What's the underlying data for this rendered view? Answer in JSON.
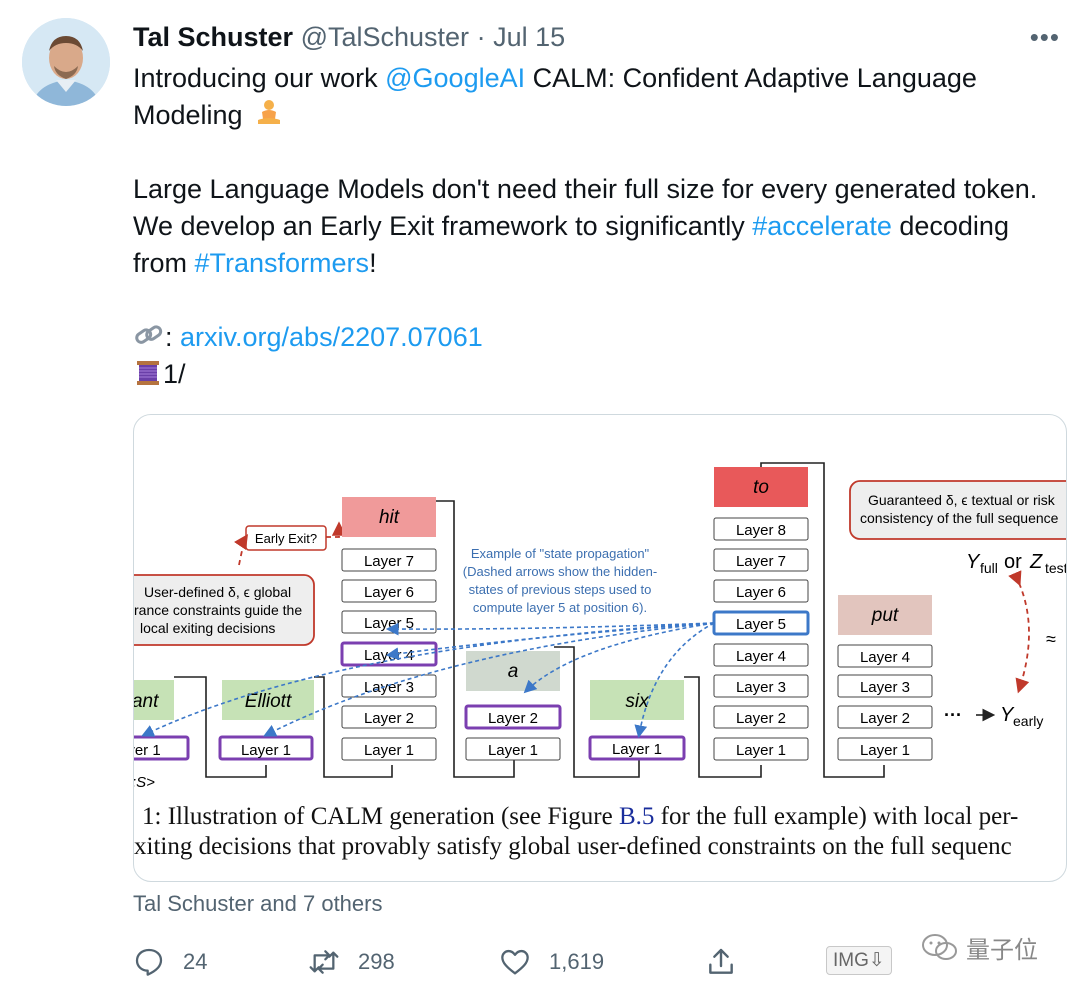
{
  "author": {
    "name": "Tal Schuster",
    "handle": "@TalSchuster",
    "separator": "·",
    "date": "Jul 15"
  },
  "more_label": "•••",
  "tweet": {
    "line1_prefix": "Introducing our work ",
    "mention": "@GoogleAI",
    "line1_suffix": " CALM: Confident Adaptive Language Modeling",
    "para2_prefix": "Large Language Models don't need their full size for every generated token. We develop an Early Exit framework to significantly ",
    "hashtag1": "#accelerate",
    "para2_mid": " decoding from ",
    "hashtag2": "#Transformers",
    "para2_suffix": "!",
    "link_sep": ": ",
    "link": "arxiv.org/abs/2207.07061",
    "thread": "1/"
  },
  "figure": {
    "boxes": {
      "early_exit": "Early Exit?",
      "guaranteed_1": "Guaranteed δ, ϵ textual or risk",
      "guaranteed_2": "consistency of the full sequence",
      "user_1": "User-defined δ, ϵ global",
      "user_2": "rance constraints guide the",
      "user_3": "local exiting decisions"
    },
    "state_note": [
      "Example of \"state propagation\"",
      "(Dashed arrows show the hidden-",
      "states of previous steps used to",
      "compute layer 5 at position 6)."
    ],
    "tokens": [
      "rant",
      "Elliott",
      "hit",
      "a",
      "six",
      "to",
      "put"
    ],
    "layers": {
      "l1": "Layer 1",
      "l2": "Layer 2",
      "l3": "Layer 3",
      "l4": "Layer 4",
      "l5": "Layer 5",
      "l6": "Layer 6",
      "l7": "Layer 7",
      "l8": "Layer 8",
      "partial_l1": "yer 1"
    },
    "start_token": ":S>",
    "y_full": "Y",
    "y_full_sub": "full",
    "or": " or ",
    "z_test": "Z",
    "z_test_sub": "test",
    "approx": "≈",
    "dots": "···",
    "y_early": "Y",
    "y_early_sub": "early",
    "caption_line1_a": "1: Illustration of CALM generation (see Figure ",
    "caption_ref": "B.5",
    "caption_line1_b": " for the full example) with local per-",
    "caption_line2": "xiting decisions that provably satisfy global user-defined constraints on the full sequenc"
  },
  "likers": "Tal Schuster and 7 others",
  "actions": {
    "reply_count": "24",
    "retweet_count": "298",
    "like_count": "1,619"
  },
  "badge": "IMG⇩",
  "watermark": "量子位",
  "colors": {
    "link": "#1d9bf0",
    "secondary": "#536471",
    "token_red": "#e8595a",
    "token_green": "#c6e2b6",
    "token_grey": "#d0d9cf",
    "token_rose": "#e2c5be",
    "purple": "#7b3fb0",
    "blue": "#3c78c8"
  }
}
